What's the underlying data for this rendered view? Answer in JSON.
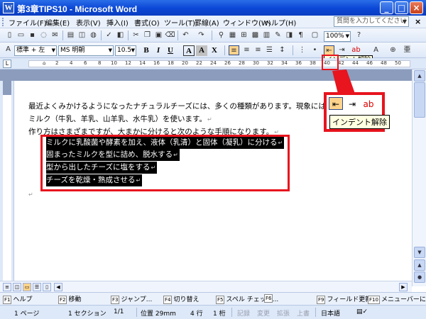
{
  "window": {
    "title": "第3章TIPS10 - Microsoft Word",
    "app_icon": "W",
    "minimize": "_",
    "maximize": "□",
    "close": "×"
  },
  "menu": {
    "items": [
      "ファイル(F)",
      "編集(E)",
      "表示(V)",
      "挿入(I)",
      "書式(O)",
      "ツール(T)",
      "罫線(A)",
      "ウィンドウ(W)",
      "ヘルプ(H)"
    ],
    "question_placeholder": "質問を入力してください",
    "close_doc": "×"
  },
  "toolbar": {
    "zoom": "100%",
    "style": "標準 + 左",
    "font": "MS 明朝",
    "font_size": "10.5",
    "bold": "B",
    "italic": "I",
    "underline": "U",
    "char_border": "A",
    "char_shade": "A",
    "char_scale": "X",
    "tooltip": "インデント解除"
  },
  "ruler": {
    "tab_selector": "L",
    "numbers": [
      "2",
      "4",
      "6",
      "8",
      "10",
      "12",
      "14",
      "16",
      "18",
      "20",
      "22",
      "24",
      "26",
      "28",
      "30",
      "32",
      "34",
      "36",
      "38",
      "40",
      "42",
      "44",
      "46",
      "48",
      "50"
    ]
  },
  "document": {
    "lines": [
      "最近よくみかけるようになったナチュラルチーズには、多くの種類があります。現象には",
      "ミルク（牛乳、羊乳、山羊乳、水牛乳）を使います。",
      "作り方はさまざまですが、大まかに分けると次のような手順になります。"
    ],
    "selected_lines": [
      "ミルクに乳酸菌や酵素を加え、液体（乳清）と固体（凝乳）に分ける",
      "固まったミルクを型に詰め、脱水する",
      "型から出したチーズに塩をする",
      "チーズを乾燥・熟成させる"
    ],
    "para_mark": "↵"
  },
  "callout": {
    "tooltip": "インデント解除",
    "icons": [
      "decrease-indent-icon",
      "increase-indent-icon",
      "highlight-icon"
    ]
  },
  "fkeys": [
    {
      "key": "F1",
      "label": "ヘルプ"
    },
    {
      "key": "F2",
      "label": "移動"
    },
    {
      "key": "F3",
      "label": "ジャンプ..."
    },
    {
      "key": "F4",
      "label": "切り替え"
    },
    {
      "key": "F5",
      "label": "スペル チェック..."
    },
    {
      "key": "F6",
      "label": ""
    },
    {
      "key": "F9",
      "label": "フィールド更新"
    },
    {
      "key": "F10",
      "label": "メニューバーに"
    }
  ],
  "status": {
    "page": "1 ページ",
    "section": "1 セクション",
    "page_count": "1/1",
    "position": "位置 29mm",
    "line": "4 行",
    "column": "1 桁",
    "rec": "記録",
    "trk": "変更",
    "ext": "拡張",
    "ovr": "上書",
    "lang": "日本語",
    "status_icon": "book-check-icon"
  },
  "colors": {
    "title_blue": "#0a46d6",
    "callout_red": "#e8141e",
    "selection": "#000000",
    "tooltip_bg": "#ffffe1"
  }
}
